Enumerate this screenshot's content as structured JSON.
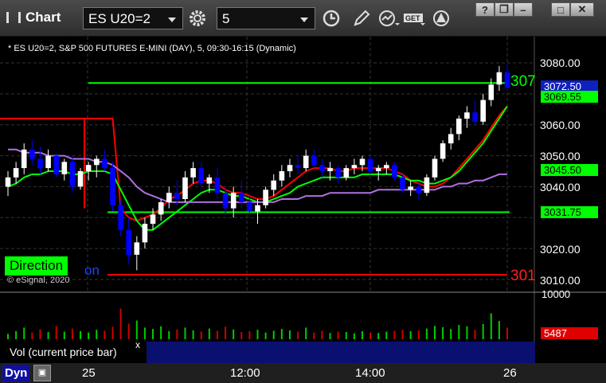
{
  "window": {
    "title": "Chart",
    "symbol": "ES U20=2",
    "interval": "5",
    "icons": [
      "gear-icon",
      "clock-icon",
      "pencil-icon",
      "study-icon",
      "get-icon",
      "alert-icon",
      "help-icon",
      "restore-icon",
      "minimize-icon",
      "maximize-icon",
      "close-icon"
    ]
  },
  "chart": {
    "subtitle": "* ES U20=2, S&P 500 FUTURES E-MINI (DAY), 5, 09:30-16:15 (Dynamic)",
    "copyright": "© eSignal, 2020",
    "direction_label": "Direction",
    "direction_tail": "on",
    "right_edge_label_top": "307",
    "right_edge_label_bottom": "301",
    "price_tags": {
      "last": "3072.50",
      "ma_fast": "3069.55",
      "mid": "3045.50",
      "low_line": "3031.75"
    },
    "colors": {
      "up": "#ffffff",
      "down": "#0000ff",
      "green": "#00ff00",
      "red": "#ff0000",
      "purple": "#b070e0"
    }
  },
  "volume": {
    "label": "Vol (current price bar)",
    "close": "x",
    "last_value": "5487",
    "axis_top": "10000"
  },
  "bottom": {
    "dyn": "Dyn",
    "x_ticks": [
      "25",
      "12:00",
      "14:00",
      "26"
    ]
  },
  "chart_data": {
    "type": "candlestick",
    "y_axis_ticks": [
      3080,
      3070,
      3060,
      3050,
      3040,
      3030,
      3020,
      3010
    ],
    "ylim": [
      3008,
      3083
    ],
    "x_ticks": [
      "25",
      "12:00",
      "14:00",
      "26"
    ],
    "horizontal_lines": [
      {
        "color": "#00ff00",
        "value": 3073.5
      },
      {
        "color": "#ff0000",
        "value": 3011.5
      },
      {
        "color": "#00ff00",
        "value": 3031.75
      }
    ],
    "candles": [
      [
        3040,
        3045,
        3037,
        3043
      ],
      [
        3043,
        3048,
        3041,
        3046
      ],
      [
        3046,
        3054,
        3044,
        3052
      ],
      [
        3052,
        3055,
        3047,
        3049
      ],
      [
        3049,
        3053,
        3044,
        3046
      ],
      [
        3046,
        3052,
        3045,
        3050
      ],
      [
        3050,
        3051,
        3043,
        3044
      ],
      [
        3044,
        3049,
        3042,
        3048
      ],
      [
        3048,
        3050,
        3038,
        3040
      ],
      [
        3040,
        3046,
        3039,
        3045
      ],
      [
        3045,
        3048,
        3042,
        3047
      ],
      [
        3047,
        3050,
        3043,
        3049
      ],
      [
        3049,
        3052,
        3045,
        3046
      ],
      [
        3046,
        3048,
        3032,
        3034
      ],
      [
        3034,
        3036,
        3024,
        3026
      ],
      [
        3026,
        3030,
        3015,
        3018
      ],
      [
        3018,
        3024,
        3013,
        3022
      ],
      [
        3022,
        3030,
        3020,
        3028
      ],
      [
        3028,
        3033,
        3026,
        3031
      ],
      [
        3031,
        3036,
        3029,
        3035
      ],
      [
        3035,
        3040,
        3033,
        3038
      ],
      [
        3038,
        3042,
        3034,
        3036
      ],
      [
        3036,
        3045,
        3035,
        3043
      ],
      [
        3043,
        3048,
        3041,
        3046
      ],
      [
        3046,
        3048,
        3040,
        3041
      ],
      [
        3041,
        3044,
        3038,
        3043
      ],
      [
        3043,
        3046,
        3036,
        3038
      ],
      [
        3038,
        3040,
        3031,
        3033
      ],
      [
        3033,
        3040,
        3030,
        3038
      ],
      [
        3038,
        3042,
        3033,
        3035
      ],
      [
        3035,
        3037,
        3030,
        3032
      ],
      [
        3032,
        3036,
        3028,
        3034
      ],
      [
        3034,
        3040,
        3033,
        3039
      ],
      [
        3039,
        3044,
        3037,
        3042
      ],
      [
        3042,
        3047,
        3040,
        3045
      ],
      [
        3045,
        3049,
        3043,
        3047
      ],
      [
        3047,
        3050,
        3044,
        3046
      ],
      [
        3046,
        3052,
        3045,
        3050
      ],
      [
        3050,
        3052,
        3046,
        3047
      ],
      [
        3047,
        3049,
        3043,
        3045
      ],
      [
        3045,
        3048,
        3042,
        3046
      ],
      [
        3046,
        3047,
        3041,
        3043
      ],
      [
        3043,
        3047,
        3042,
        3046
      ],
      [
        3046,
        3049,
        3044,
        3047
      ],
      [
        3047,
        3050,
        3045,
        3049
      ],
      [
        3049,
        3050,
        3044,
        3045
      ],
      [
        3045,
        3047,
        3042,
        3046
      ],
      [
        3046,
        3048,
        3044,
        3047
      ],
      [
        3047,
        3048,
        3042,
        3043
      ],
      [
        3043,
        3044,
        3038,
        3039
      ],
      [
        3039,
        3042,
        3037,
        3040
      ],
      [
        3040,
        3041,
        3036,
        3038
      ],
      [
        3038,
        3044,
        3037,
        3043
      ],
      [
        3043,
        3050,
        3042,
        3049
      ],
      [
        3049,
        3055,
        3048,
        3054
      ],
      [
        3054,
        3059,
        3052,
        3057
      ],
      [
        3057,
        3063,
        3055,
        3062
      ],
      [
        3062,
        3066,
        3059,
        3064
      ],
      [
        3064,
        3068,
        3060,
        3061
      ],
      [
        3061,
        3070,
        3060,
        3068
      ],
      [
        3068,
        3075,
        3066,
        3073
      ],
      [
        3073,
        3079,
        3071,
        3077
      ],
      [
        3077,
        3080,
        3071,
        3072
      ]
    ],
    "series": [
      {
        "color": "#ff0000",
        "values": [
          3062,
          3062,
          3062,
          3062,
          3062,
          3062,
          3062,
          3062,
          3062,
          3062,
          3062,
          3062,
          3062,
          3062,
          3033,
          3030,
          3029,
          3030,
          3031,
          3033,
          3036,
          3037,
          3039,
          3041,
          3042,
          3042,
          3041,
          3039,
          3038,
          3038,
          3037,
          3036,
          3036,
          3037,
          3039,
          3041,
          3043,
          3045,
          3046,
          3046,
          3046,
          3045,
          3045,
          3046,
          3046,
          3046,
          3046,
          3046,
          3045,
          3044,
          3042,
          3041,
          3040,
          3040,
          3041,
          3043,
          3046,
          3049,
          3052,
          3055,
          3059,
          3063,
          3066
        ]
      },
      {
        "color": "#00ff00",
        "values": [
          3040,
          3041,
          3043,
          3044,
          3044,
          3045,
          3045,
          3045,
          3044,
          3044,
          3045,
          3045,
          3045,
          3044,
          3039,
          3034,
          3029,
          3026,
          3026,
          3028,
          3030,
          3032,
          3034,
          3036,
          3038,
          3039,
          3039,
          3038,
          3037,
          3037,
          3036,
          3035,
          3035,
          3036,
          3037,
          3038,
          3040,
          3041,
          3042,
          3043,
          3043,
          3043,
          3043,
          3043,
          3044,
          3044,
          3044,
          3044,
          3044,
          3043,
          3042,
          3042,
          3041,
          3041,
          3042,
          3043,
          3045,
          3048,
          3051,
          3054,
          3058,
          3062,
          3066
        ]
      },
      {
        "color": "#b070e0",
        "values": [
          3052,
          3052,
          3051,
          3051,
          3051,
          3050,
          3050,
          3050,
          3049,
          3049,
          3049,
          3048,
          3048,
          3047,
          3045,
          3043,
          3040,
          3038,
          3037,
          3036,
          3035,
          3035,
          3035,
          3035,
          3035,
          3035,
          3035,
          3035,
          3035,
          3035,
          3035,
          3035,
          3035,
          3035,
          3036,
          3036,
          3036,
          3037,
          3037,
          3037,
          3038,
          3038,
          3038,
          3038,
          3038,
          3038,
          3039,
          3039,
          3039,
          3039,
          3039,
          3039,
          3039,
          3039,
          3040,
          3040,
          3041,
          3041,
          3042,
          3042,
          3043,
          3044,
          3044
        ]
      }
    ],
    "volume_values": [
      1200,
      1800,
      2600,
      1500,
      2200,
      1600,
      3000,
      1700,
      2400,
      1800,
      1500,
      2100,
      1900,
      2800,
      6900,
      3500,
      4200,
      2600,
      2300,
      2900,
      1800,
      2200,
      2600,
      2000,
      1700,
      2400,
      1900,
      2800,
      2200,
      1600,
      1800,
      2100,
      1500,
      1900,
      2300,
      2000,
      1700,
      2600,
      1500,
      1900,
      1400,
      1700,
      1600,
      1300,
      1800,
      1500,
      1400,
      1700,
      1900,
      2100,
      1800,
      2000,
      2400,
      3000,
      2700,
      2300,
      3200,
      2900,
      2100,
      3400,
      5800,
      4100,
      2600
    ],
    "volume_ylim": [
      0,
      10000
    ]
  }
}
